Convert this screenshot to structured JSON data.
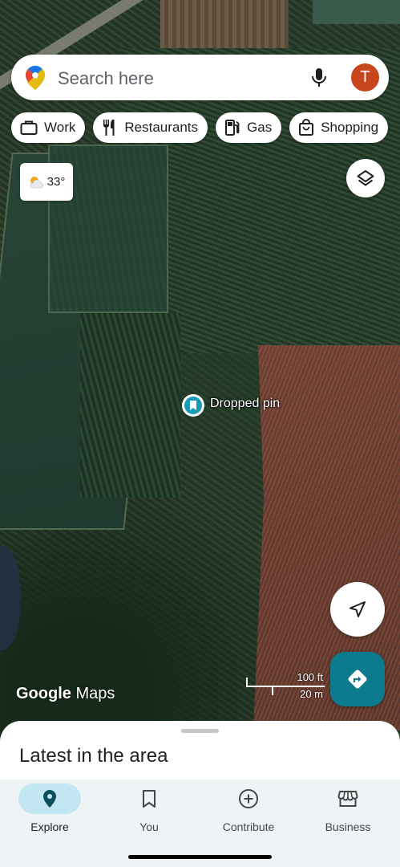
{
  "search": {
    "placeholder": "Search here",
    "avatar_letter": "T"
  },
  "chips": [
    {
      "label": "Work",
      "icon": "briefcase-icon"
    },
    {
      "label": "Restaurants",
      "icon": "fork-knife-icon"
    },
    {
      "label": "Gas",
      "icon": "gas-station-icon"
    },
    {
      "label": "Shopping",
      "icon": "shopping-bag-icon"
    }
  ],
  "weather": {
    "temp": "33°",
    "icon": "partly-sunny-icon"
  },
  "pin": {
    "label": "Dropped pin"
  },
  "scale": {
    "imperial": "100 ft",
    "metric": "20 m"
  },
  "watermark": {
    "brand": "Google",
    "product": "Maps"
  },
  "sheet": {
    "title": "Latest in the area"
  },
  "nav": {
    "items": [
      {
        "label": "Explore",
        "icon": "location-pin-icon",
        "active": true
      },
      {
        "label": "You",
        "icon": "bookmark-icon",
        "active": false
      },
      {
        "label": "Contribute",
        "icon": "add-circle-icon",
        "active": false
      },
      {
        "label": "Business",
        "icon": "storefront-icon",
        "active": false
      }
    ]
  },
  "colors": {
    "accent": "#0b7b8d",
    "avatar": "#c8461d",
    "pin": "#1a9bb5",
    "nav_active": "#c2e7f3"
  }
}
